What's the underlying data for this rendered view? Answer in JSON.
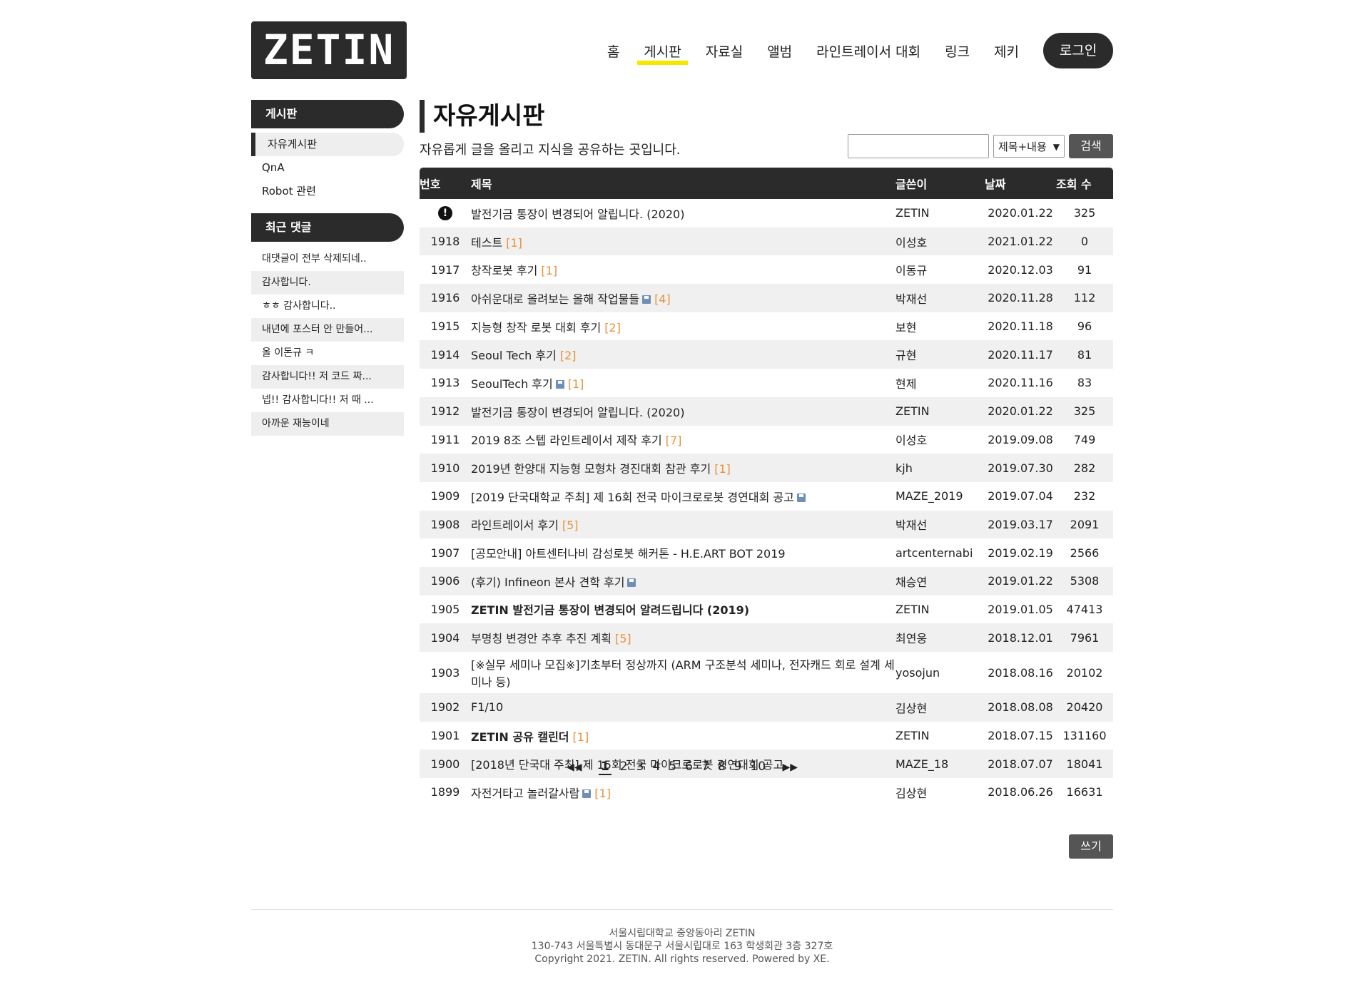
{
  "logo": "ZETIN",
  "nav": [
    "홈",
    "게시판",
    "자료실",
    "앨범",
    "라인트레이서 대회",
    "링크",
    "제키"
  ],
  "login_label": "로그인",
  "sidebar": {
    "board_title": "게시판",
    "board_items": [
      "자유게시판",
      "QnA",
      "Robot 관련"
    ],
    "comments_title": "최근 댓글",
    "comments": [
      "대댓글이 전부 삭제되네..",
      "감사합니다.",
      "ㅎㅎ 감사합니다..",
      "내년에 포스터 안 만들어...",
      "올 이돈규 ㅋ",
      "감사합니다!! 저 코드 짜...",
      "넵!! 감사합니다!! 저 때 ...",
      "아까운 재능이네"
    ]
  },
  "main": {
    "title": "자유게시판",
    "description": "자유롭게 글을 올리고 지식을 공유하는 곳입니다.",
    "search_input_value": "",
    "search_option": "제목+내용",
    "search_button": "검색",
    "columns": [
      "번호",
      "제목",
      "글쓴이",
      "날짜",
      "조회 수"
    ],
    "rows": [
      {
        "no": "",
        "notice": true,
        "title": "발전기금 통장이 변경되어 알립니다. (2020)",
        "file": false,
        "count": "",
        "bold": false,
        "author": "ZETIN",
        "date": "2020.01.22",
        "views": "325"
      },
      {
        "no": "1918",
        "title": "테스트",
        "file": false,
        "count": "[1]",
        "author": "이성호",
        "date": "2021.01.22",
        "views": "0"
      },
      {
        "no": "1917",
        "title": "창작로봇 후기",
        "file": false,
        "count": "[1]",
        "author": "이동규",
        "date": "2020.12.03",
        "views": "91"
      },
      {
        "no": "1916",
        "title": "아쉬운대로 올려보는 올해 작업물들",
        "file": true,
        "count": "[4]",
        "author": "박재선",
        "date": "2020.11.28",
        "views": "112"
      },
      {
        "no": "1915",
        "title": "지능형 창작 로봇 대회 후기",
        "file": false,
        "count": "[2]",
        "author": "보현",
        "date": "2020.11.18",
        "views": "96"
      },
      {
        "no": "1914",
        "title": "Seoul Tech 후기",
        "file": false,
        "count": "[2]",
        "author": "규현",
        "date": "2020.11.17",
        "views": "81"
      },
      {
        "no": "1913",
        "title": "SeoulTech 후기",
        "file": true,
        "count": "[1]",
        "author": "현제",
        "date": "2020.11.16",
        "views": "83"
      },
      {
        "no": "1912",
        "title": "발전기금 통장이 변경되어 알립니다. (2020)",
        "file": false,
        "count": "",
        "author": "ZETIN",
        "date": "2020.01.22",
        "views": "325"
      },
      {
        "no": "1911",
        "title": "2019 8조 스텝 라인트레이서 제작 후기",
        "file": false,
        "count": "[7]",
        "author": "이성호",
        "date": "2019.09.08",
        "views": "749"
      },
      {
        "no": "1910",
        "title": "2019년 한양대 지능형 모형차 경진대회 참관 후기",
        "file": false,
        "count": "[1]",
        "author": "kjh",
        "date": "2019.07.30",
        "views": "282"
      },
      {
        "no": "1909",
        "title": "[2019 단국대학교 주최] 제 16회 전국 마이크로로봇 경연대회 공고",
        "file": true,
        "count": "",
        "author": "MAZE_2019",
        "date": "2019.07.04",
        "views": "232"
      },
      {
        "no": "1908",
        "title": "라인트레이서 후기",
        "file": false,
        "count": "[5]",
        "author": "박재선",
        "date": "2019.03.17",
        "views": "2091"
      },
      {
        "no": "1907",
        "title": "[공모안내] 아트센터나비 감성로봇 해커톤 - H.E.ART BOT 2019",
        "file": false,
        "count": "",
        "author": "artcenternabi",
        "date": "2019.02.19",
        "views": "2566"
      },
      {
        "no": "1906",
        "title": "(후기) Infineon 본사 견학 후기",
        "file": true,
        "count": "",
        "author": "채승연",
        "date": "2019.01.22",
        "views": "5308"
      },
      {
        "no": "1905",
        "title": "ZETIN 발전기금 통장이 변경되어 알려드립니다 (2019)",
        "file": false,
        "count": "",
        "bold": true,
        "author": "ZETIN",
        "date": "2019.01.05",
        "views": "47413"
      },
      {
        "no": "1904",
        "title": "부명칭 변경안 추후 추진 계획",
        "file": false,
        "count": "[5]",
        "author": "최연웅",
        "date": "2018.12.01",
        "views": "7961"
      },
      {
        "no": "1903",
        "title": "[※실무 세미나 모집※]기초부터 정상까지 (ARM 구조분석 세미나, 전자캐드 회로 설계 세미나 등)",
        "file": false,
        "count": "",
        "tall": true,
        "author": "yosojun",
        "date": "2018.08.16",
        "views": "20102"
      },
      {
        "no": "1902",
        "title": "F1/10",
        "file": false,
        "count": "",
        "author": "김상현",
        "date": "2018.08.08",
        "views": "20420"
      },
      {
        "no": "1901",
        "title": "ZETIN 공유 캘린더",
        "file": false,
        "count": "[1]",
        "bold": true,
        "author": "ZETIN",
        "date": "2018.07.15",
        "views": "131160"
      },
      {
        "no": "1900",
        "title": "[2018년 단국대 주최] 제 15회 전국 마이크로로봇 경연대회 공고",
        "file": false,
        "count": "",
        "author": "MAZE_18",
        "date": "2018.07.07",
        "views": "18041"
      },
      {
        "no": "1899",
        "title": "자전거타고 놀러갈사람",
        "file": true,
        "count": "[1]",
        "author": "김상현",
        "date": "2018.06.26",
        "views": "16631"
      }
    ],
    "write_button": "쓰기",
    "pages": [
      "1",
      "2",
      "3",
      "4",
      "5",
      "6",
      "7",
      "8",
      "9",
      "10"
    ],
    "current_page": "1"
  },
  "footer": {
    "line1": "서울시립대학교 중앙동아리 ZETIN",
    "line2": "130-743 서울특별시 동대문구 서울시립대로 163 학생회관 3층 327호",
    "line3": "Copyright 2021. ZETIN. All rights reserved. Powered by XE."
  },
  "colors": {
    "dark": "#2b2b2b",
    "accent_underline": "#f7e600",
    "comment_count": "#e8923a",
    "button": "#555555"
  },
  "icons": {
    "notice": "exclamation-circle-icon",
    "file": "floppy-disk-icon",
    "first": "first-page-icon",
    "last": "last-page-icon"
  }
}
